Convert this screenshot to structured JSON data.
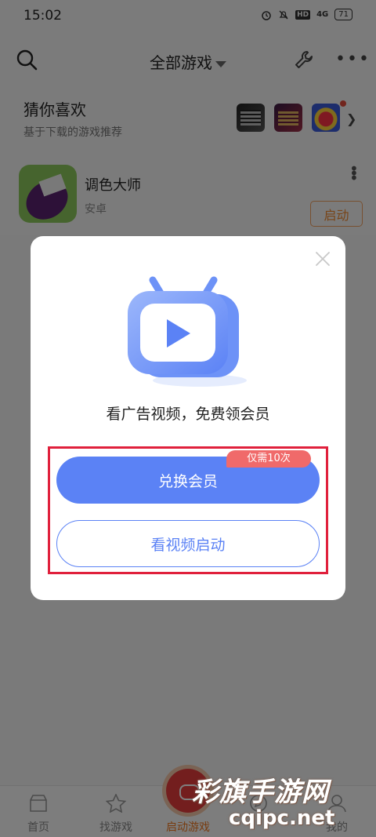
{
  "status_bar": {
    "time": "15:02",
    "hd": "HD",
    "network": "4G",
    "battery": "71"
  },
  "header": {
    "title": "全部游戏",
    "icons": [
      "search-icon",
      "wrench-icon",
      "more-icon"
    ]
  },
  "recommend": {
    "title": "猜你喜欢",
    "subtitle": "基于下载的游戏推荐"
  },
  "game": {
    "name": "调色大师",
    "platform": "安卓",
    "launch_label": "启动"
  },
  "dialog": {
    "promo_text": "看广告视频，免费领会员",
    "redeem_label": "兑换会员",
    "badge_text": "仅需10次",
    "watch_label": "看视频启动"
  },
  "bottom_nav": {
    "items": [
      {
        "label": "首页",
        "icon": "home-icon"
      },
      {
        "label": "找游戏",
        "icon": "star-icon"
      },
      {
        "label": "启动游戏",
        "icon": "gamepad-icon"
      },
      {
        "label": "",
        "icon": "compass-icon"
      },
      {
        "label": "我的",
        "icon": "profile-icon"
      }
    ]
  },
  "watermark": {
    "line1": "彩旗手游网",
    "line2": "cqipc.net"
  },
  "colors": {
    "accent_blue": "#5b82f5",
    "accent_orange": "#f07820",
    "badge_red": "#f06a6a",
    "highlight_red": "#e0203c"
  }
}
